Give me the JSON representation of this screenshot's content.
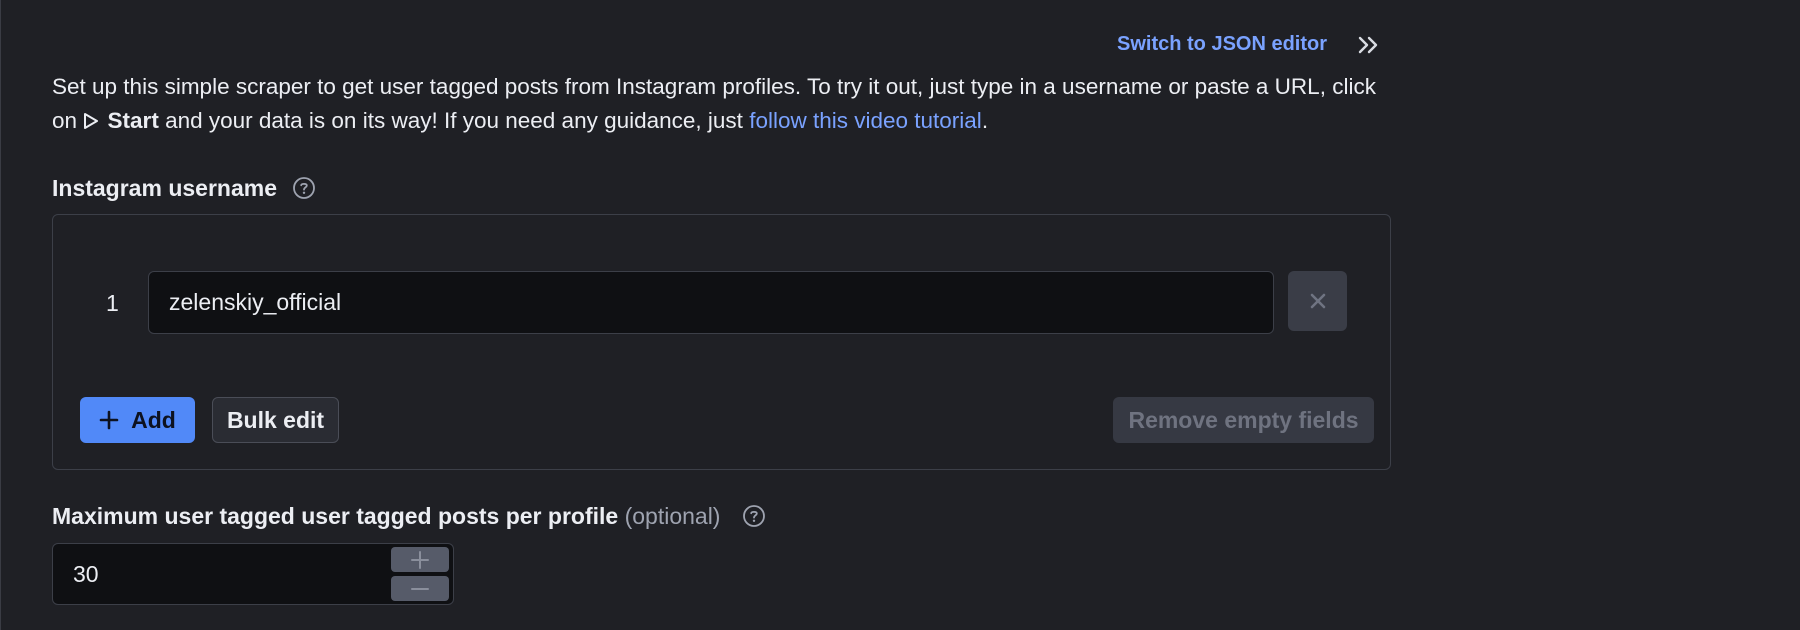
{
  "header": {
    "switch_editor_label": "Switch to JSON editor"
  },
  "intro": {
    "text_before_start": "Set up this simple scraper to get user tagged posts from Instagram profiles. To try it out, just type in a username or paste a URL, click on ",
    "start_label": "Start",
    "text_after_start": " and your data is on its way! If you need any guidance, just ",
    "link_text": "follow this video tutorial",
    "trailing": "."
  },
  "username_field": {
    "label": "Instagram username",
    "rows": [
      {
        "number": "1",
        "value": "zelenskiy_official"
      }
    ],
    "add_label": "Add",
    "bulk_edit_label": "Bulk edit",
    "remove_empty_label": "Remove empty fields"
  },
  "max_posts_field": {
    "label": "Maximum user tagged user tagged posts per profile",
    "optional_label": "(optional)",
    "value": "30"
  },
  "icons": {
    "collapse": "double-chevron-right-icon",
    "help": "question-circle-icon",
    "remove": "close-icon",
    "add": "plus-icon",
    "increment": "plus-icon",
    "decrement": "minus-icon",
    "start": "play-outline-icon"
  },
  "colors": {
    "background": "#1f2025",
    "accent": "#5189f8",
    "link": "#7aa2ff",
    "text": "#eceef3",
    "muted": "#9ea3b0"
  }
}
